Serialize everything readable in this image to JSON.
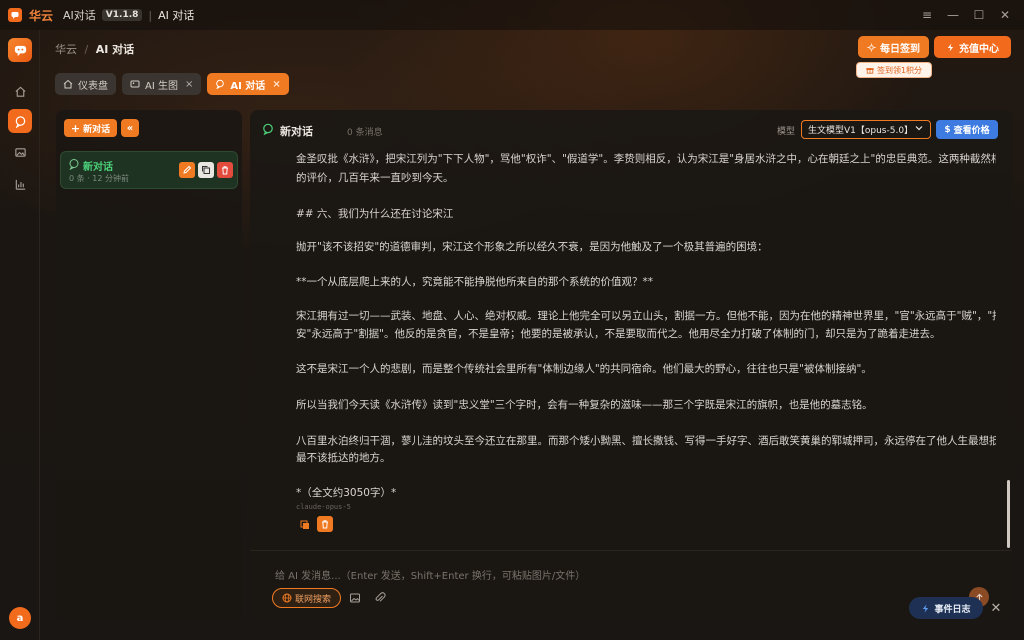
{
  "titlebar": {
    "brand": "华云",
    "app_name": "AI对话",
    "version": "V1.1.8",
    "separator": "|",
    "page": "AI 对话",
    "controls": {
      "menu": "≡",
      "minimize": "—",
      "maximize": "☐",
      "close": "✕"
    }
  },
  "breadcrumb": {
    "root": "华云",
    "sep": "/",
    "current": "AI 对话"
  },
  "header_buttons": {
    "checkin": "每日签到",
    "checkin_hint": "签到领1积分",
    "recharge": "充值中心"
  },
  "tabs": [
    {
      "label": "仪表盘",
      "closable": false
    },
    {
      "label": "AI 生图",
      "closable": true
    },
    {
      "label": "AI 对话",
      "closable": true
    }
  ],
  "tab_close": "×",
  "sidebar": {
    "new_chat": "新对话",
    "new_chat_plus": "+",
    "collapse": "«",
    "conversation": {
      "title": "新对话",
      "meta": "0 条 · 12 分钟前"
    }
  },
  "chat": {
    "title": "新对话",
    "count": "0 条消息",
    "model_label": "模型",
    "model_value": "生文模型V1【opus-5.0】",
    "price_button": "查看价格",
    "price_prefix": "$",
    "lines": [
      "金圣叹批《水浒》，把宋江列为\"下下人物\"，骂他\"权诈\"、\"假道学\"。李贽则相反，认为宋江是\"身居水浒之中，心在朝廷之上\"的忠臣典范。这两种截然相反",
      "的评价，几百年来一直吵到今天。",
      "## 六、我们为什么还在讨论宋江",
      "抛开\"该不该招安\"的道德审判，宋江这个形象之所以经久不衰，是因为他触及了一个极其普遍的困境：",
      "**一个从底层爬上来的人，究竟能不能挣脱他所来自的那个系统的价值观？**",
      "宋江拥有过一切——武装、地盘、人心、绝对权威。理论上他完全可以另立山头，割据一方。但他不能，因为在他的精神世界里，\"官\"永远高于\"贼\"，\"招",
      "安\"永远高于\"割据\"。他反的是贪官，不是皇帝；他要的是被承认，不是要取而代之。他用尽全力打破了体制的门，却只是为了跪着走进去。",
      "这不是宋江一个人的悲剧，而是整个传统社会里所有\"体制边缘人\"的共同宿命。他们最大的野心，往往也只是\"被体制接纳\"。",
      "所以当我们今天读《水浒传》读到\"忠义堂\"三个字时，会有一种复杂的滋味——那三个字既是宋江的旗帜，也是他的墓志铭。",
      "八百里水泊终归干涸，蓼儿洼的坟头至今还立在那里。而那个矮小黝黑、擅长撒钱、写得一手好字、酒后敢笑黄巢的郓城押司，永远停在了他人生最想抵达也",
      "最不该抵达的地方。",
      "*（全文约3050字）*"
    ],
    "model_tag": "claude-opus-5"
  },
  "input": {
    "placeholder": "给 AI 发消息...（Enter 发送，Shift+Enter 换行，可粘贴图片/文件）",
    "web_search": "联网搜索"
  },
  "event_log": {
    "label": "事件日志",
    "close": "✕"
  },
  "avatar": "a",
  "colors": {
    "accent": "#f07a22",
    "green": "#4bd17a",
    "blue": "#3d7be0"
  }
}
